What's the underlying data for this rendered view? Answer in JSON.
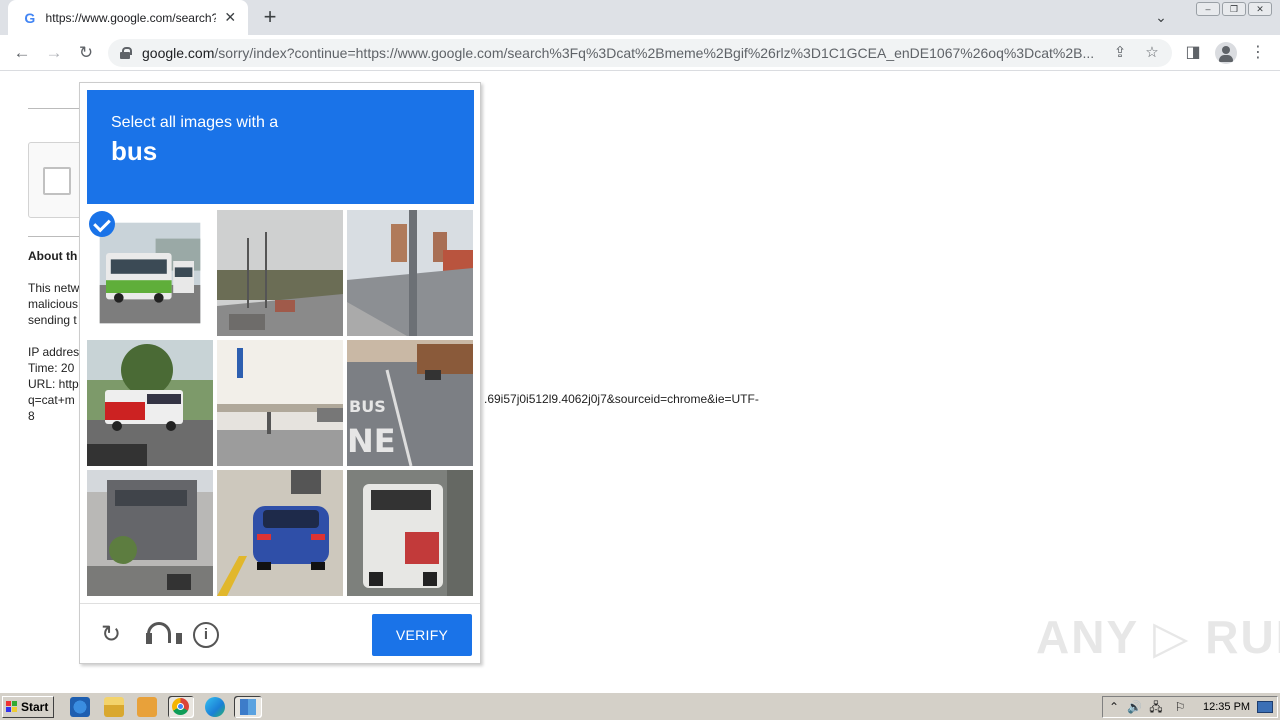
{
  "browser": {
    "tab": {
      "favicon": "G",
      "title": "https://www.google.com/search?q=",
      "close": "✕"
    },
    "new_tab": "+",
    "tab_search": "⌄",
    "window_buttons": [
      "–",
      "❐",
      "✕"
    ],
    "nav": {
      "back": "←",
      "forward": "→",
      "reload": "↻"
    },
    "address": {
      "host": "google.com",
      "path": "/sorry/index?continue=https://www.google.com/search%3Fq%3Dcat%2Bmeme%2Bgif%26rlz%3D1C1GCEA_enDE1067%26oq%3Dcat%2B..."
    },
    "icons": {
      "share": "⇪",
      "bookmark": "☆",
      "side_panel": "◨",
      "menu": "⋮"
    }
  },
  "page": {
    "about_heading": "About th",
    "para1": [
      "This netw",
      "malicious",
      "sending t"
    ],
    "info": [
      "IP addres",
      "Time: 20",
      "URL: http",
      "q=cat+m",
      "8"
    ],
    "url_tail": ".69i57j0i512l9.4062j0j7&sourceid=chrome&ie=UTF-"
  },
  "challenge": {
    "instruction": "Select all images with a",
    "keyword": "bus",
    "tiles": [
      {
        "name": "tile-bus-green",
        "selected": true
      },
      {
        "name": "tile-road-poles",
        "selected": false
      },
      {
        "name": "tile-street-buildings",
        "selected": false
      },
      {
        "name": "tile-bus-red",
        "selected": false
      },
      {
        "name": "tile-truck-side",
        "selected": false
      },
      {
        "name": "tile-bus-lane",
        "selected": false
      },
      {
        "name": "tile-building",
        "selected": false
      },
      {
        "name": "tile-blue-car",
        "selected": false
      },
      {
        "name": "tile-bus-rear",
        "selected": false
      }
    ],
    "footer": {
      "reload_icon": "↻",
      "info_icon": "i",
      "verify_label": "VERIFY"
    }
  },
  "watermark": "ANY ▷ RUN",
  "taskbar": {
    "start_label": "Start",
    "tray_icons": [
      "⌃",
      "🔊",
      "🖧",
      "⚐"
    ],
    "clock": "12:35 PM"
  }
}
